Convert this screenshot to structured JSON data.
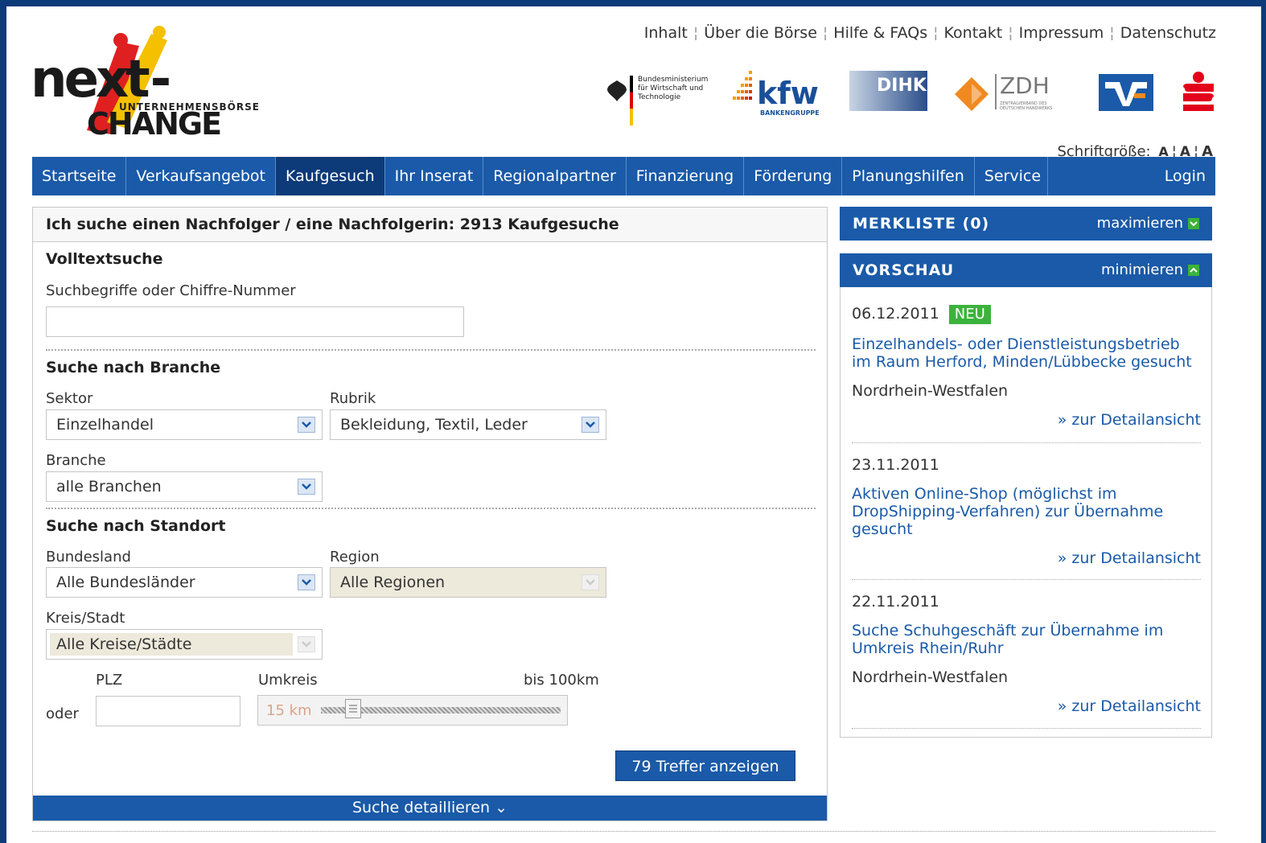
{
  "toplinks": [
    "Inhalt",
    "Über die Börse",
    "Hilfe & FAQs",
    "Kontakt",
    "Impressum",
    "Datenschutz"
  ],
  "logo": {
    "line1": "nex",
    "line2": "UNTERNEHMENSBÖRSE",
    "line3": "CHANGE"
  },
  "partners": {
    "bmwi": "Bundesministerium für Wirtschaft und Technologie",
    "kfw": "kfw",
    "kfw_sub": "BANKENGRUPPE",
    "dihk": "DIHK",
    "zdh": "ZDH",
    "zdh_sub": "ZENTRALVERBAND DES DEUTSCHEN HANDWERKS"
  },
  "fontsize": {
    "label": "Schriftgröße:",
    "a1": "A",
    "a2": "A",
    "a3": "A"
  },
  "nav": {
    "items": [
      "Startseite",
      "Verkaufsangebot",
      "Kaufgesuch",
      "Ihr Inserat",
      "Regionalpartner",
      "Finanzierung",
      "Förderung",
      "Planungshilfen",
      "Service"
    ],
    "active": "Kaufgesuch",
    "login": "Login"
  },
  "main": {
    "heading": "Ich suche einen Nachfolger / eine Nachfolgerin: 2913 Kaufgesuche",
    "fulltext": {
      "title": "Volltextsuche",
      "label": "Suchbegriffe oder Chiffre-Nummer",
      "value": ""
    },
    "branch": {
      "title": "Suche nach Branche",
      "sektor_label": "Sektor",
      "sektor_value": "Einzelhandel",
      "rubrik_label": "Rubrik",
      "rubrik_value": "Bekleidung, Textil, Leder",
      "branche_label": "Branche",
      "branche_value": "alle Branchen"
    },
    "location": {
      "title": "Suche nach Standort",
      "bundesland_label": "Bundesland",
      "bundesland_value": "Alle Bundesländer",
      "region_label": "Region",
      "region_value": "Alle Regionen",
      "kreis_label": "Kreis/Stadt",
      "kreis_value": "Alle Kreise/Städte",
      "plz_label": "PLZ",
      "plz_value": "",
      "oder_label": "oder",
      "umkreis_label": "Umkreis",
      "umkreis_max": "bis 100km",
      "umkreis_value": "15 km"
    },
    "search_button": "79 Treffer anzeigen",
    "detail_link": "Suche detaillieren ⌄"
  },
  "merkliste": {
    "title": "MERKLISTE (0)",
    "action": "maximieren"
  },
  "vorschau": {
    "title": "VORSCHAU",
    "action": "minimieren",
    "entries": [
      {
        "date": "06.12.2011",
        "badge": "NEU",
        "title": "Einzelhandels- oder Dienstleistungsbetrieb im Raum Herford, Minden/Lübbecke gesucht",
        "location": "Nordrhein-Westfalen",
        "link": "» zur Detailansicht"
      },
      {
        "date": "23.11.2011",
        "title": "Aktiven Online-Shop (möglichst im DropShipping-Verfahren) zur Übernahme gesucht",
        "link": "» zur Detailansicht"
      },
      {
        "date": "22.11.2011",
        "title": "Suche Schuhgeschäft zur Übernahme im Umkreis Rhein/Ruhr",
        "location": "Nordrhein-Westfalen",
        "link": "» zur Detailansicht"
      }
    ]
  },
  "colors": {
    "nav": "#1a5aa8",
    "nav_active": "#0d3a78",
    "badge": "#3bb33b",
    "link": "#1a5aa8"
  }
}
